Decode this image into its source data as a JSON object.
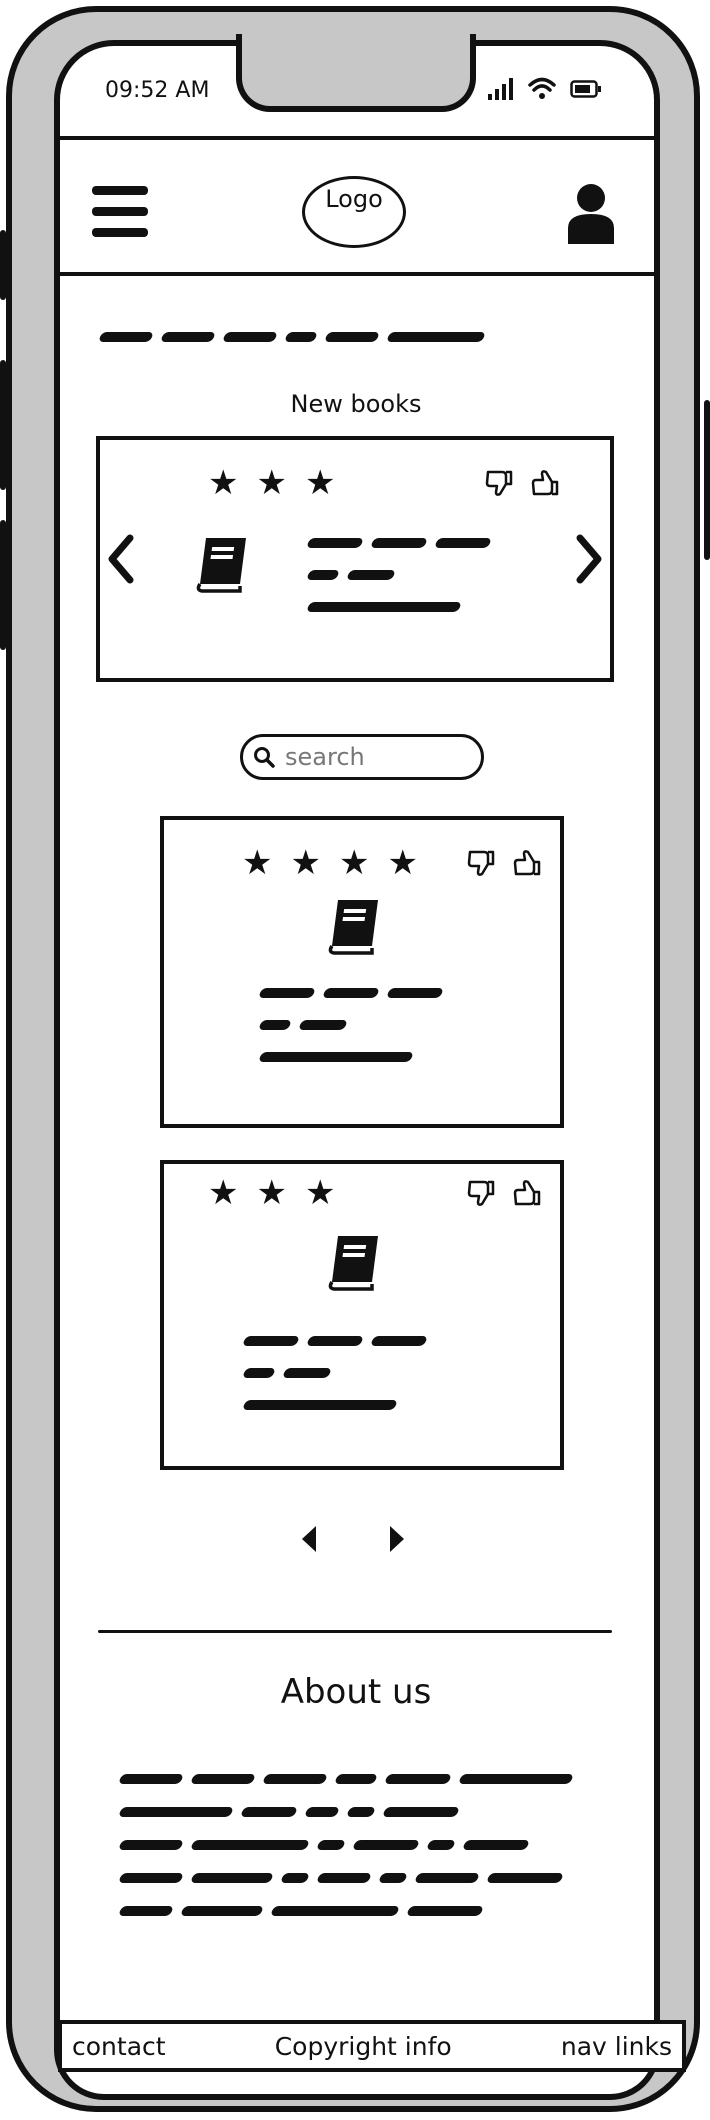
{
  "status_bar": {
    "time": "09:52 AM"
  },
  "header": {
    "logo": "Logo"
  },
  "new_books": {
    "title": "New books",
    "featured": {
      "rating": 3
    }
  },
  "search": {
    "placeholder": "search"
  },
  "book_cards": [
    {
      "rating": 4
    },
    {
      "rating": 3
    }
  ],
  "about": {
    "title": "About us"
  },
  "footer": {
    "contact": "contact",
    "copyright": "Copyright info",
    "nav_links": "nav links"
  },
  "icons": {
    "menu": "hamburger-menu-icon",
    "user": "user-icon",
    "book": "book-icon",
    "star": "star-icon",
    "thumbs_up": "thumbs-up-icon",
    "thumbs_down": "thumbs-down-icon",
    "search": "search-icon"
  }
}
